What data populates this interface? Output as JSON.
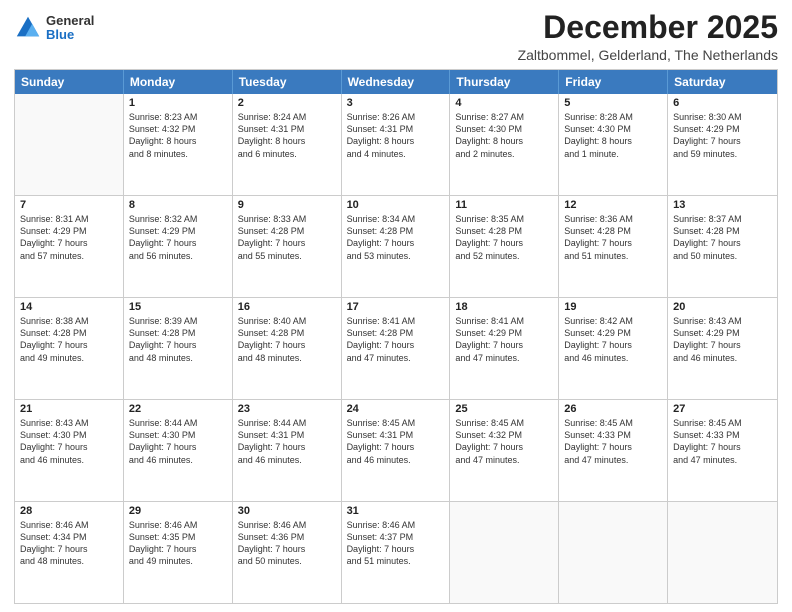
{
  "logo": {
    "general": "General",
    "blue": "Blue"
  },
  "title": "December 2025",
  "location": "Zaltbommel, Gelderland, The Netherlands",
  "header_days": [
    "Sunday",
    "Monday",
    "Tuesday",
    "Wednesday",
    "Thursday",
    "Friday",
    "Saturday"
  ],
  "weeks": [
    [
      {
        "day": "",
        "lines": []
      },
      {
        "day": "1",
        "lines": [
          "Sunrise: 8:23 AM",
          "Sunset: 4:32 PM",
          "Daylight: 8 hours",
          "and 8 minutes."
        ]
      },
      {
        "day": "2",
        "lines": [
          "Sunrise: 8:24 AM",
          "Sunset: 4:31 PM",
          "Daylight: 8 hours",
          "and 6 minutes."
        ]
      },
      {
        "day": "3",
        "lines": [
          "Sunrise: 8:26 AM",
          "Sunset: 4:31 PM",
          "Daylight: 8 hours",
          "and 4 minutes."
        ]
      },
      {
        "day": "4",
        "lines": [
          "Sunrise: 8:27 AM",
          "Sunset: 4:30 PM",
          "Daylight: 8 hours",
          "and 2 minutes."
        ]
      },
      {
        "day": "5",
        "lines": [
          "Sunrise: 8:28 AM",
          "Sunset: 4:30 PM",
          "Daylight: 8 hours",
          "and 1 minute."
        ]
      },
      {
        "day": "6",
        "lines": [
          "Sunrise: 8:30 AM",
          "Sunset: 4:29 PM",
          "Daylight: 7 hours",
          "and 59 minutes."
        ]
      }
    ],
    [
      {
        "day": "7",
        "lines": [
          "Sunrise: 8:31 AM",
          "Sunset: 4:29 PM",
          "Daylight: 7 hours",
          "and 57 minutes."
        ]
      },
      {
        "day": "8",
        "lines": [
          "Sunrise: 8:32 AM",
          "Sunset: 4:29 PM",
          "Daylight: 7 hours",
          "and 56 minutes."
        ]
      },
      {
        "day": "9",
        "lines": [
          "Sunrise: 8:33 AM",
          "Sunset: 4:28 PM",
          "Daylight: 7 hours",
          "and 55 minutes."
        ]
      },
      {
        "day": "10",
        "lines": [
          "Sunrise: 8:34 AM",
          "Sunset: 4:28 PM",
          "Daylight: 7 hours",
          "and 53 minutes."
        ]
      },
      {
        "day": "11",
        "lines": [
          "Sunrise: 8:35 AM",
          "Sunset: 4:28 PM",
          "Daylight: 7 hours",
          "and 52 minutes."
        ]
      },
      {
        "day": "12",
        "lines": [
          "Sunrise: 8:36 AM",
          "Sunset: 4:28 PM",
          "Daylight: 7 hours",
          "and 51 minutes."
        ]
      },
      {
        "day": "13",
        "lines": [
          "Sunrise: 8:37 AM",
          "Sunset: 4:28 PM",
          "Daylight: 7 hours",
          "and 50 minutes."
        ]
      }
    ],
    [
      {
        "day": "14",
        "lines": [
          "Sunrise: 8:38 AM",
          "Sunset: 4:28 PM",
          "Daylight: 7 hours",
          "and 49 minutes."
        ]
      },
      {
        "day": "15",
        "lines": [
          "Sunrise: 8:39 AM",
          "Sunset: 4:28 PM",
          "Daylight: 7 hours",
          "and 48 minutes."
        ]
      },
      {
        "day": "16",
        "lines": [
          "Sunrise: 8:40 AM",
          "Sunset: 4:28 PM",
          "Daylight: 7 hours",
          "and 48 minutes."
        ]
      },
      {
        "day": "17",
        "lines": [
          "Sunrise: 8:41 AM",
          "Sunset: 4:28 PM",
          "Daylight: 7 hours",
          "and 47 minutes."
        ]
      },
      {
        "day": "18",
        "lines": [
          "Sunrise: 8:41 AM",
          "Sunset: 4:29 PM",
          "Daylight: 7 hours",
          "and 47 minutes."
        ]
      },
      {
        "day": "19",
        "lines": [
          "Sunrise: 8:42 AM",
          "Sunset: 4:29 PM",
          "Daylight: 7 hours",
          "and 46 minutes."
        ]
      },
      {
        "day": "20",
        "lines": [
          "Sunrise: 8:43 AM",
          "Sunset: 4:29 PM",
          "Daylight: 7 hours",
          "and 46 minutes."
        ]
      }
    ],
    [
      {
        "day": "21",
        "lines": [
          "Sunrise: 8:43 AM",
          "Sunset: 4:30 PM",
          "Daylight: 7 hours",
          "and 46 minutes."
        ]
      },
      {
        "day": "22",
        "lines": [
          "Sunrise: 8:44 AM",
          "Sunset: 4:30 PM",
          "Daylight: 7 hours",
          "and 46 minutes."
        ]
      },
      {
        "day": "23",
        "lines": [
          "Sunrise: 8:44 AM",
          "Sunset: 4:31 PM",
          "Daylight: 7 hours",
          "and 46 minutes."
        ]
      },
      {
        "day": "24",
        "lines": [
          "Sunrise: 8:45 AM",
          "Sunset: 4:31 PM",
          "Daylight: 7 hours",
          "and 46 minutes."
        ]
      },
      {
        "day": "25",
        "lines": [
          "Sunrise: 8:45 AM",
          "Sunset: 4:32 PM",
          "Daylight: 7 hours",
          "and 47 minutes."
        ]
      },
      {
        "day": "26",
        "lines": [
          "Sunrise: 8:45 AM",
          "Sunset: 4:33 PM",
          "Daylight: 7 hours",
          "and 47 minutes."
        ]
      },
      {
        "day": "27",
        "lines": [
          "Sunrise: 8:45 AM",
          "Sunset: 4:33 PM",
          "Daylight: 7 hours",
          "and 47 minutes."
        ]
      }
    ],
    [
      {
        "day": "28",
        "lines": [
          "Sunrise: 8:46 AM",
          "Sunset: 4:34 PM",
          "Daylight: 7 hours",
          "and 48 minutes."
        ]
      },
      {
        "day": "29",
        "lines": [
          "Sunrise: 8:46 AM",
          "Sunset: 4:35 PM",
          "Daylight: 7 hours",
          "and 49 minutes."
        ]
      },
      {
        "day": "30",
        "lines": [
          "Sunrise: 8:46 AM",
          "Sunset: 4:36 PM",
          "Daylight: 7 hours",
          "and 50 minutes."
        ]
      },
      {
        "day": "31",
        "lines": [
          "Sunrise: 8:46 AM",
          "Sunset: 4:37 PM",
          "Daylight: 7 hours",
          "and 51 minutes."
        ]
      },
      {
        "day": "",
        "lines": []
      },
      {
        "day": "",
        "lines": []
      },
      {
        "day": "",
        "lines": []
      }
    ]
  ]
}
